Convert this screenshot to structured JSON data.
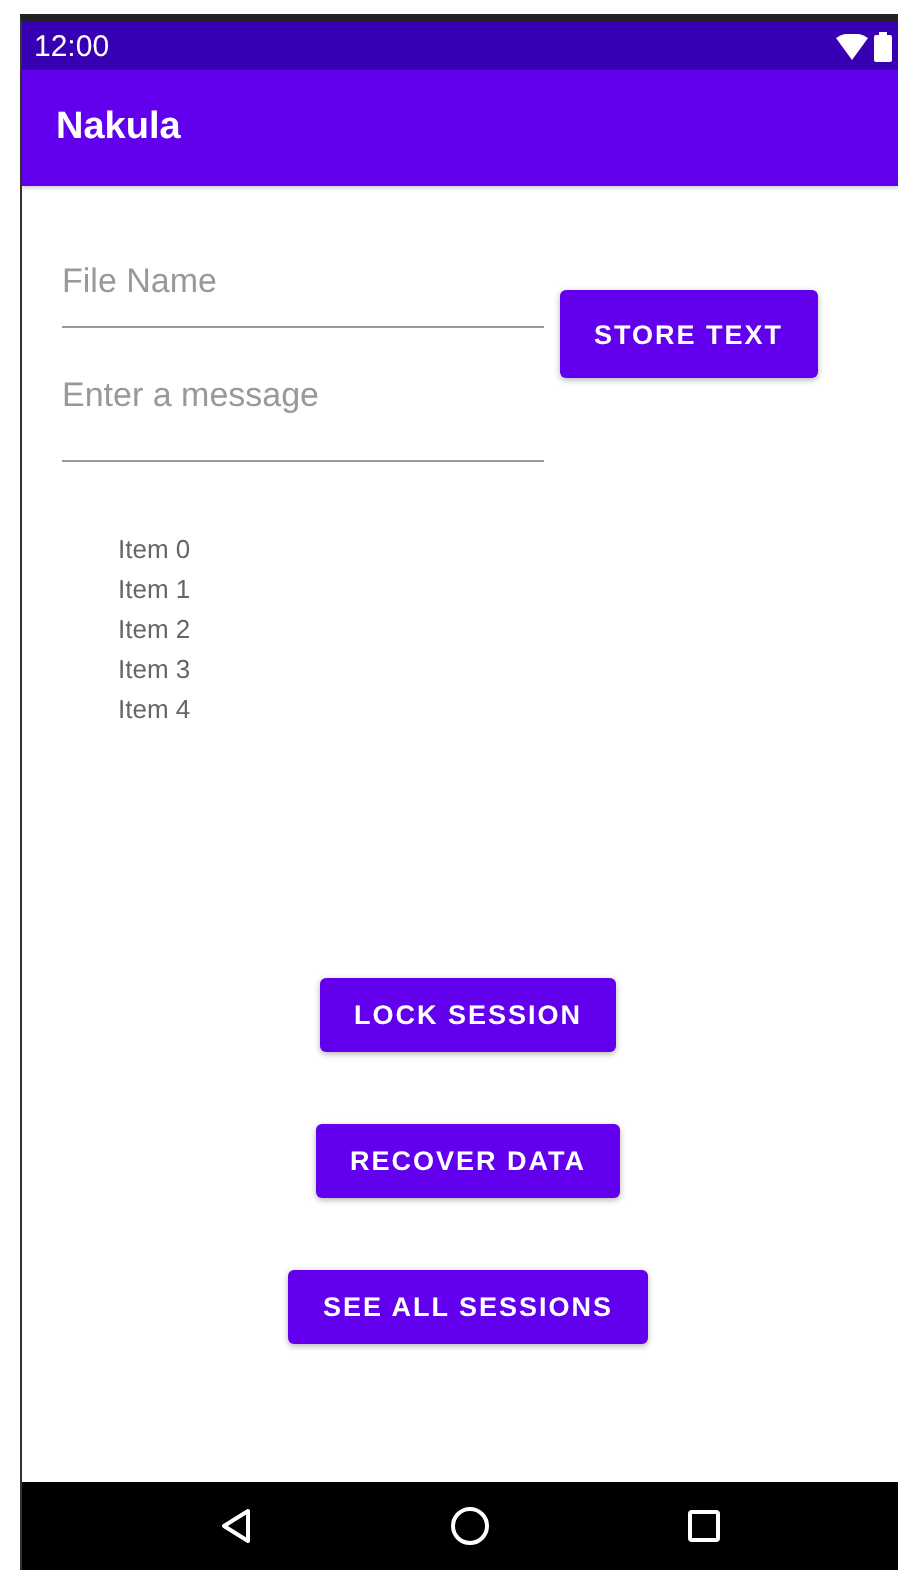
{
  "status_bar": {
    "time": "12:00"
  },
  "app_bar": {
    "title": "Nakula"
  },
  "fields": [
    {
      "placeholder": "File Name"
    },
    {
      "placeholder": "Enter a message"
    }
  ],
  "store_button": "STORE TEXT",
  "list_items": [
    "Item 0",
    "Item 1",
    "Item 2",
    "Item 3",
    "Item 4"
  ],
  "buttons": [
    "LOCK SESSION",
    "RECOVER DATA",
    "SEE ALL SESSIONS"
  ]
}
